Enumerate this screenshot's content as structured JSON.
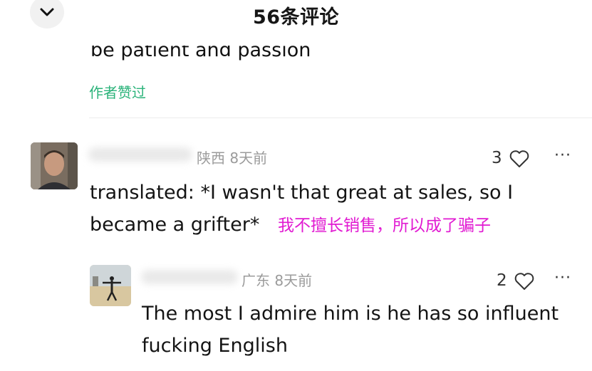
{
  "header": {
    "title": "56条评论",
    "back_icon": "chevron-down-icon"
  },
  "previous_comment": {
    "cut_text": "be patient and passion",
    "author_liked": "作者赞过"
  },
  "comments": [
    {
      "location_time": "陕西 8天前",
      "likes": "3",
      "more": "···",
      "line1": "translated: *I wasn't that great at sales, so I",
      "line2": "became a grifter*",
      "annotation": "我不擅长销售，所以成了骗子"
    },
    {
      "location_time": "广东 8天前",
      "likes": "2",
      "more": "···",
      "line1": "The most I admire him is he has so influent",
      "line2": "fucking English"
    }
  ],
  "colors": {
    "liked_green": "#2bb37a",
    "annotation_magenta": "#e11bd2",
    "meta_gray": "#9b9b9b"
  }
}
